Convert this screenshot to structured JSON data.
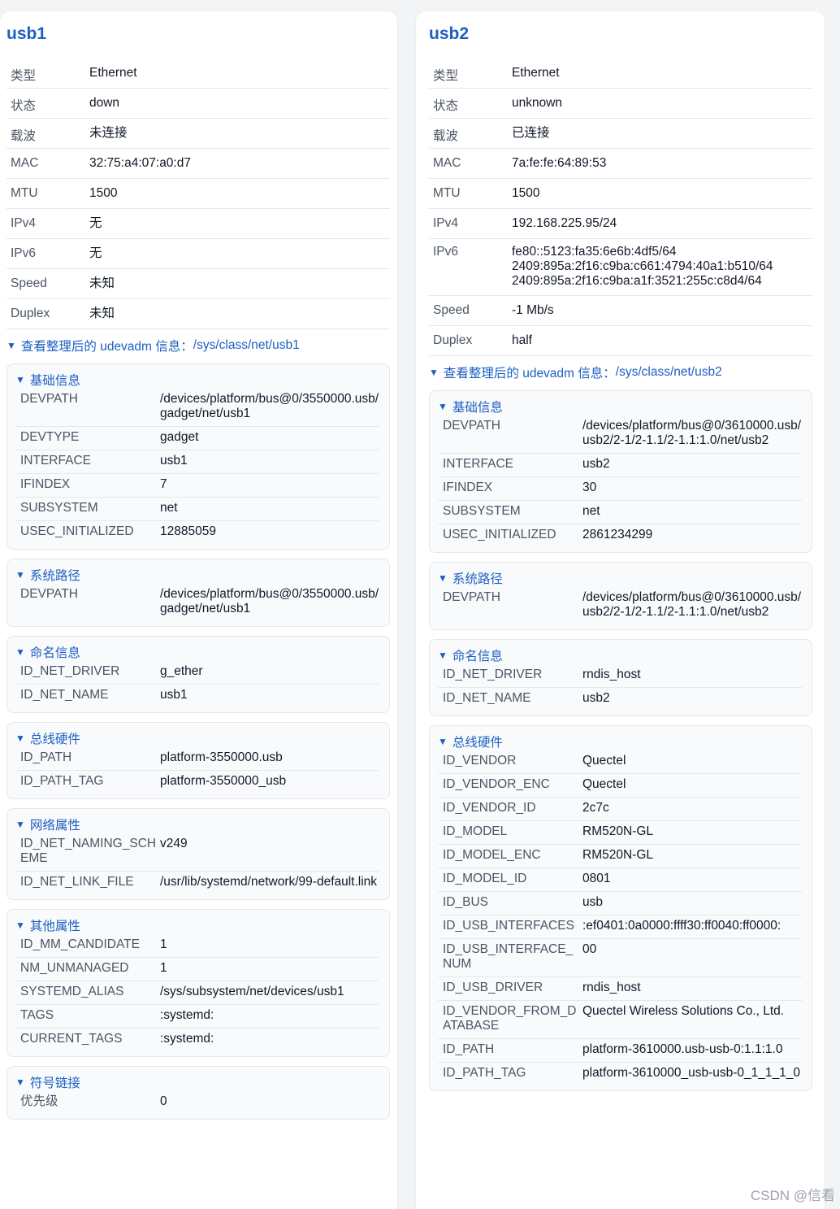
{
  "usb1": {
    "title": "usb1",
    "props": [
      {
        "k": "类型",
        "v": "Ethernet"
      },
      {
        "k": "状态",
        "v": "down"
      },
      {
        "k": "载波",
        "v": "未连接"
      },
      {
        "k": "MAC",
        "v": "32:75:a4:07:a0:d7"
      },
      {
        "k": "MTU",
        "v": "1500"
      },
      {
        "k": "IPv4",
        "v": "无"
      },
      {
        "k": "IPv6",
        "v": "无"
      },
      {
        "k": "Speed",
        "v": "未知"
      },
      {
        "k": "Duplex",
        "v": "未知"
      }
    ],
    "udev_toggle": "查看整理后的 udevadm 信息：",
    "udev_path": "/sys/class/net/usb1",
    "sections": [
      {
        "title": "基础信息",
        "rows": [
          {
            "k": "DEVPATH",
            "v": "/devices/platform/bus@0/3550000.usb/gadget/net/usb1"
          },
          {
            "k": "DEVTYPE",
            "v": "gadget"
          },
          {
            "k": "INTERFACE",
            "v": "usb1"
          },
          {
            "k": "IFINDEX",
            "v": "7"
          },
          {
            "k": "SUBSYSTEM",
            "v": "net"
          },
          {
            "k": "USEC_INITIALIZED",
            "v": "12885059"
          }
        ]
      },
      {
        "title": "系统路径",
        "rows": [
          {
            "k": "DEVPATH",
            "v": "/devices/platform/bus@0/3550000.usb/gadget/net/usb1"
          }
        ]
      },
      {
        "title": "命名信息",
        "rows": [
          {
            "k": "ID_NET_DRIVER",
            "v": "g_ether"
          },
          {
            "k": "ID_NET_NAME",
            "v": "usb1"
          }
        ]
      },
      {
        "title": "总线硬件",
        "rows": [
          {
            "k": "ID_PATH",
            "v": "platform-3550000.usb"
          },
          {
            "k": "ID_PATH_TAG",
            "v": "platform-3550000_usb"
          }
        ]
      },
      {
        "title": "网络属性",
        "rows": [
          {
            "k": "ID_NET_NAMING_SCHEME",
            "v": "v249"
          },
          {
            "k": "ID_NET_LINK_FILE",
            "v": "/usr/lib/systemd/network/99-default.link"
          }
        ]
      },
      {
        "title": "其他属性",
        "rows": [
          {
            "k": "ID_MM_CANDIDATE",
            "v": "1"
          },
          {
            "k": "NM_UNMANAGED",
            "v": "1"
          },
          {
            "k": "SYSTEMD_ALIAS",
            "v": "/sys/subsystem/net/devices/usb1"
          },
          {
            "k": "TAGS",
            "v": ":systemd:"
          },
          {
            "k": "CURRENT_TAGS",
            "v": ":systemd:"
          }
        ]
      },
      {
        "title": "符号链接",
        "rows": [
          {
            "k": "优先级",
            "v": "0"
          }
        ]
      }
    ]
  },
  "usb2": {
    "title": "usb2",
    "props": [
      {
        "k": "类型",
        "v": "Ethernet"
      },
      {
        "k": "状态",
        "v": "unknown"
      },
      {
        "k": "载波",
        "v": "已连接"
      },
      {
        "k": "MAC",
        "v": "7a:fe:fe:64:89:53"
      },
      {
        "k": "MTU",
        "v": "1500"
      },
      {
        "k": "IPv4",
        "v": "192.168.225.95/24"
      },
      {
        "k": "IPv6",
        "v": "fe80::5123:fa35:6e6b:4df5/64\n2409:895a:2f16:c9ba:c661:4794:40a1:b510/64\n2409:895a:2f16:c9ba:a1f:3521:255c:c8d4/64"
      },
      {
        "k": "Speed",
        "v": "-1 Mb/s"
      },
      {
        "k": "Duplex",
        "v": "half"
      }
    ],
    "udev_toggle": "查看整理后的 udevadm 信息：",
    "udev_path": "/sys/class/net/usb2",
    "sections": [
      {
        "title": "基础信息",
        "rows": [
          {
            "k": "DEVPATH",
            "v": "/devices/platform/bus@0/3610000.usb/usb2/2-1/2-1.1/2-1.1:1.0/net/usb2"
          },
          {
            "k": "INTERFACE",
            "v": "usb2"
          },
          {
            "k": "IFINDEX",
            "v": "30"
          },
          {
            "k": "SUBSYSTEM",
            "v": "net"
          },
          {
            "k": "USEC_INITIALIZED",
            "v": "2861234299"
          }
        ]
      },
      {
        "title": "系统路径",
        "rows": [
          {
            "k": "DEVPATH",
            "v": "/devices/platform/bus@0/3610000.usb/usb2/2-1/2-1.1/2-1.1:1.0/net/usb2"
          }
        ]
      },
      {
        "title": "命名信息",
        "rows": [
          {
            "k": "ID_NET_DRIVER",
            "v": "rndis_host"
          },
          {
            "k": "ID_NET_NAME",
            "v": "usb2"
          }
        ]
      },
      {
        "title": "总线硬件",
        "rows": [
          {
            "k": "ID_VENDOR",
            "v": "Quectel"
          },
          {
            "k": "ID_VENDOR_ENC",
            "v": "Quectel"
          },
          {
            "k": "ID_VENDOR_ID",
            "v": "2c7c"
          },
          {
            "k": "ID_MODEL",
            "v": "RM520N-GL"
          },
          {
            "k": "ID_MODEL_ENC",
            "v": "RM520N-GL"
          },
          {
            "k": "ID_MODEL_ID",
            "v": "0801"
          },
          {
            "k": "ID_BUS",
            "v": "usb"
          },
          {
            "k": "ID_USB_INTERFACES",
            "v": ":ef0401:0a0000:ffff30:ff0040:ff0000:"
          },
          {
            "k": "ID_USB_INTERFACE_NUM",
            "v": "00"
          },
          {
            "k": "ID_USB_DRIVER",
            "v": "rndis_host"
          },
          {
            "k": "ID_VENDOR_FROM_DATABASE",
            "v": "Quectel Wireless Solutions Co., Ltd."
          },
          {
            "k": "ID_PATH",
            "v": "platform-3610000.usb-usb-0:1.1:1.0"
          },
          {
            "k": "ID_PATH_TAG",
            "v": "platform-3610000_usb-usb-0_1_1_1_0"
          }
        ]
      }
    ]
  },
  "watermark": "CSDN @信看"
}
